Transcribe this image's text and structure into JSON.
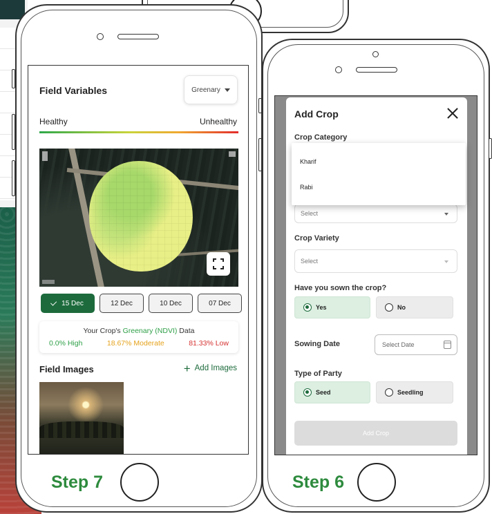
{
  "left_phone": {
    "step_label": "Step 7",
    "field_variables": {
      "title": "Field Variables",
      "dropdown_value": "Greenary",
      "scale_left": "Healthy",
      "scale_right": "Unhealthy"
    },
    "dates": [
      {
        "label": "15 Dec",
        "selected": true
      },
      {
        "label": "12 Dec",
        "selected": false
      },
      {
        "label": "10 Dec",
        "selected": false
      },
      {
        "label": "07 Dec",
        "selected": false
      }
    ],
    "ndvi": {
      "title_prefix": "Your Crop's",
      "title_highlight": "Greenary (NDVI)",
      "title_suffix": "Data",
      "high": "0.0% High",
      "moderate": "18.67% Moderate",
      "low": "81.33% Low"
    },
    "field_images": {
      "title": "Field Images",
      "add_label": "Add Images"
    },
    "icons": [
      "chevron-down-icon",
      "check-icon",
      "expand-icon",
      "plus-icon"
    ]
  },
  "right_phone": {
    "step_label": "Step 6",
    "modal_title": "Add Crop",
    "crop_category_label": "Crop Category",
    "category_options": [
      "Kharif",
      "Rabi"
    ],
    "category_select_placeholder": "Select",
    "crop_variety_label": "Crop Variety",
    "crop_variety_placeholder": "Select",
    "sown_question": "Have you sown the crop?",
    "sown_options": [
      {
        "label": "Yes",
        "selected": true
      },
      {
        "label": "No",
        "selected": false
      }
    ],
    "sowing_date_label": "Sowing Date",
    "sowing_date_placeholder": "Select Date",
    "party_label": "Type of Party",
    "party_options": [
      {
        "label": "Seed",
        "selected": true
      },
      {
        "label": "Seedling",
        "selected": false
      }
    ],
    "submit_label": "Add Crop",
    "icons": [
      "close-icon",
      "calendar-icon",
      "chevron-down-icon"
    ]
  },
  "colors": {
    "brand_green": "#1d6b3c",
    "step_green": "#2e8b3e",
    "high": "#2fa048",
    "moderate": "#e5a21b",
    "low": "#d63131"
  }
}
